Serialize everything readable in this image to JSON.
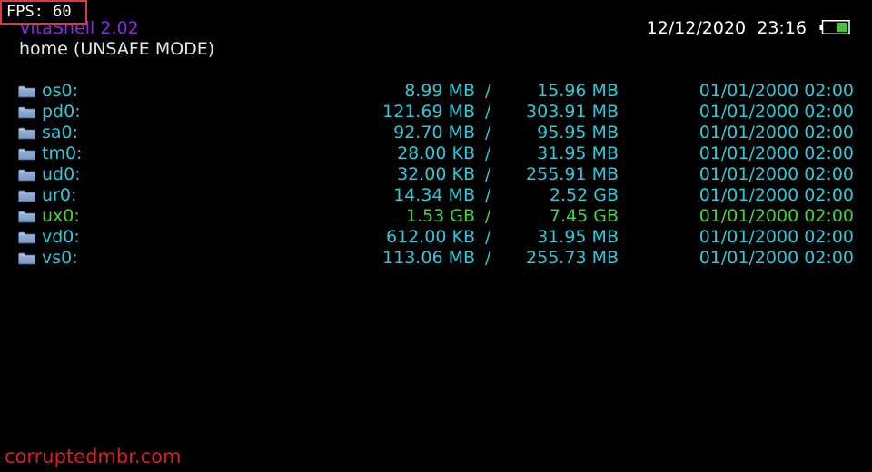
{
  "overlay": {
    "fps_label": "FPS: 60"
  },
  "header": {
    "app_title": "VitaShell 2.02",
    "path": "home (UNSAFE MODE)",
    "date": "12/12/2020",
    "time": "23:16",
    "battery_icon": "battery-icon"
  },
  "colors": {
    "title": "#8a2be2",
    "entry": "#2fc8d8",
    "selected_entry": "#3fd63c",
    "fps_border": "#e0383e",
    "watermark": "#d91f1f"
  },
  "devices": [
    {
      "name": "os0:",
      "used": "8.99 MB",
      "separator": "/",
      "total": "15.96 MB",
      "date": "01/01/2000 02:00",
      "selected": false
    },
    {
      "name": "pd0:",
      "used": "121.69 MB",
      "separator": "/",
      "total": "303.91 MB",
      "date": "01/01/2000 02:00",
      "selected": false
    },
    {
      "name": "sa0:",
      "used": "92.70 MB",
      "separator": "/",
      "total": "95.95 MB",
      "date": "01/01/2000 02:00",
      "selected": false
    },
    {
      "name": "tm0:",
      "used": "28.00 KB",
      "separator": "/",
      "total": "31.95 MB",
      "date": "01/01/2000 02:00",
      "selected": false
    },
    {
      "name": "ud0:",
      "used": "32.00 KB",
      "separator": "/",
      "total": "255.91 MB",
      "date": "01/01/2000 02:00",
      "selected": false
    },
    {
      "name": "ur0:",
      "used": "14.34 MB",
      "separator": "/",
      "total": "2.52 GB",
      "date": "01/01/2000 02:00",
      "selected": false
    },
    {
      "name": "ux0:",
      "used": "1.53 GB",
      "separator": "/",
      "total": "7.45 GB",
      "date": "01/01/2000 02:00",
      "selected": true
    },
    {
      "name": "vd0:",
      "used": "612.00 KB",
      "separator": "/",
      "total": "31.95 MB",
      "date": "01/01/2000 02:00",
      "selected": false
    },
    {
      "name": "vs0:",
      "used": "113.06 MB",
      "separator": "/",
      "total": "255.73 MB",
      "date": "01/01/2000 02:00",
      "selected": false
    }
  ],
  "watermark": "corruptedmbr.com"
}
